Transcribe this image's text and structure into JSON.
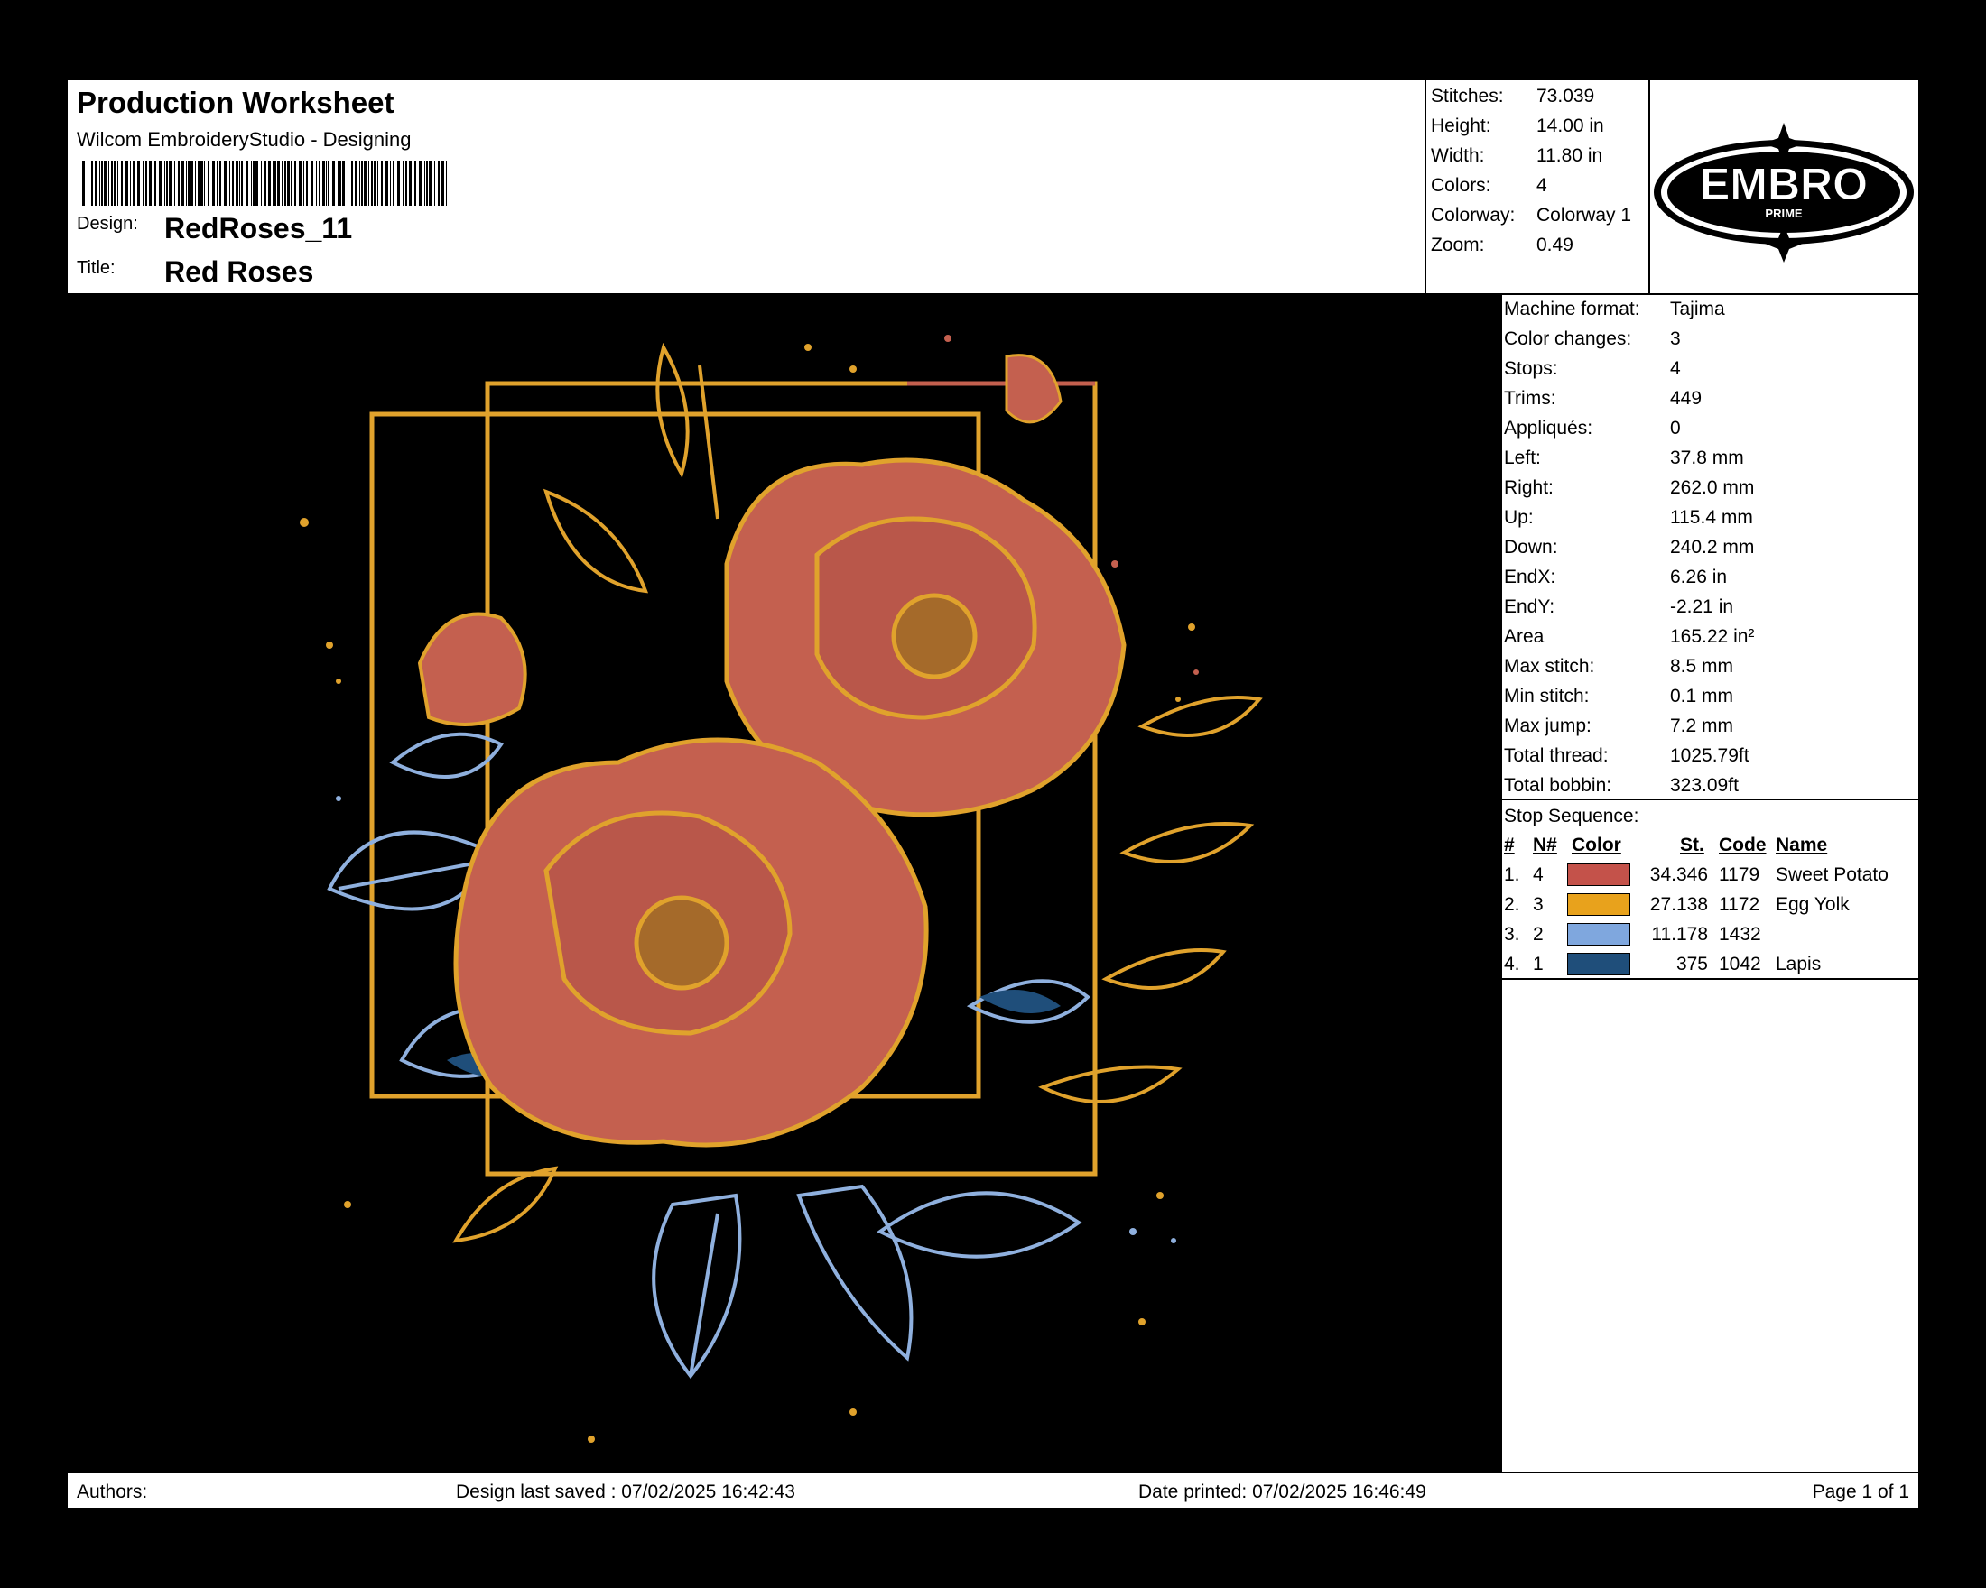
{
  "header": {
    "title": "Production Worksheet",
    "software": "Wilcom EmbroideryStudio - Designing",
    "design_label": "Design:",
    "design_value": "RedRoses_11",
    "title_label": "Title:",
    "title_value": "Red Roses"
  },
  "summary": [
    {
      "label": "Stitches:",
      "value": "73.039"
    },
    {
      "label": "Height:",
      "value": "14.00 in"
    },
    {
      "label": "Width:",
      "value": "11.80 in"
    },
    {
      "label": "Colors:",
      "value": "4"
    },
    {
      "label": "Colorway:",
      "value": "Colorway 1"
    },
    {
      "label": "Zoom:",
      "value": "0.49"
    }
  ],
  "logo": {
    "text": "EMBRO",
    "subtext": "PRIME"
  },
  "details": [
    {
      "label": "Machine format:",
      "value": "Tajima"
    },
    {
      "label": "Color changes:",
      "value": "3"
    },
    {
      "label": "Stops:",
      "value": "4"
    },
    {
      "label": "Trims:",
      "value": "449"
    },
    {
      "label": "Appliqués:",
      "value": "0"
    },
    {
      "label": "Left:",
      "value": "37.8 mm"
    },
    {
      "label": "Right:",
      "value": "262.0 mm"
    },
    {
      "label": "Up:",
      "value": "115.4 mm"
    },
    {
      "label": "Down:",
      "value": "240.2 mm"
    },
    {
      "label": "EndX:",
      "value": "6.26 in"
    },
    {
      "label": "EndY:",
      "value": "-2.21 in"
    },
    {
      "label": "Area",
      "value": "165.22 in²"
    },
    {
      "label": "Max stitch:",
      "value": "8.5 mm"
    },
    {
      "label": "Min stitch:",
      "value": "0.1 mm"
    },
    {
      "label": "Max jump:",
      "value": "7.2 mm"
    },
    {
      "label": "Total thread:",
      "value": "1025.79ft"
    },
    {
      "label": "Total bobbin:",
      "value": "323.09ft"
    }
  ],
  "stop_sequence": {
    "title": "Stop Sequence:",
    "headers": {
      "num": "#",
      "n": "N#",
      "color": "Color",
      "st": "St.",
      "code": "Code",
      "name": "Name"
    },
    "rows": [
      {
        "num": "1.",
        "n": "4",
        "color": "#c4524a",
        "st": "34.346",
        "code": "1179",
        "name": "Sweet Potato"
      },
      {
        "num": "2.",
        "n": "3",
        "color": "#e8a21c",
        "st": "27.138",
        "code": "1172",
        "name": "Egg Yolk"
      },
      {
        "num": "3.",
        "n": "2",
        "color": "#7fa7de",
        "st": "11.178",
        "code": "1432",
        "name": ""
      },
      {
        "num": "4.",
        "n": "1",
        "color": "#1f4e7a",
        "st": "375",
        "code": "1042",
        "name": "Lapis"
      }
    ]
  },
  "footer": {
    "authors": "Authors:",
    "saved": "Design last saved : 07/02/2025 16:42:43",
    "printed": "Date printed: 07/02/2025 16:46:49",
    "page": "Page 1 of 1"
  },
  "colors": {
    "petal": "#c4604f",
    "gold": "#e0a22c",
    "blue": "#8fb0de",
    "navy": "#1f4e7a"
  }
}
